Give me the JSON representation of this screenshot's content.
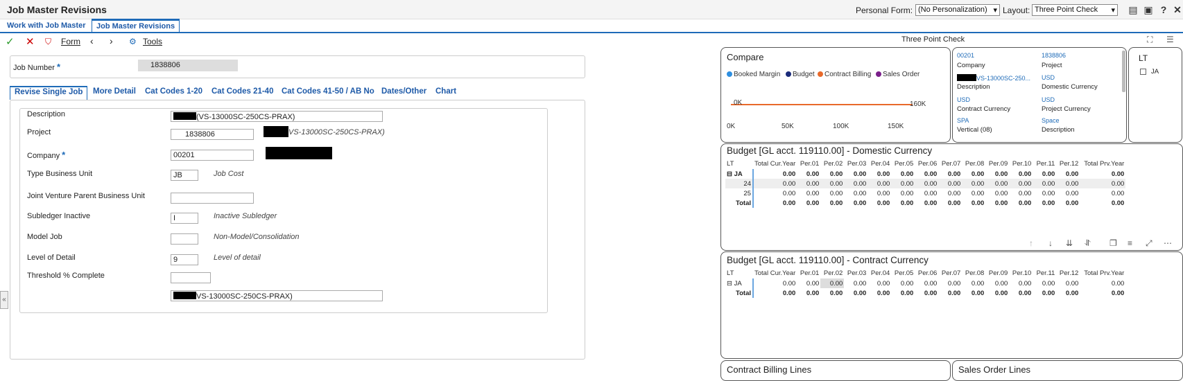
{
  "header": {
    "title": "Job Master Revisions",
    "personal_form_label": "Personal Form:",
    "personal_form_value": "(No Personalization)",
    "layout_label": "Layout:",
    "layout_value": "Three Point Check"
  },
  "app_tabs": [
    "Work with Job Master",
    "Job Master Revisions"
  ],
  "toolbar": {
    "form_label": "Form",
    "tools_label": "Tools"
  },
  "job": {
    "label": "Job Number",
    "value": "1838806"
  },
  "form_tabs": [
    "Revise Single Job",
    "More Detail",
    "Cat Codes 1-20",
    "Cat Codes 21-40",
    "Cat Codes 41-50 / AB No",
    "Dates/Other",
    "Chart"
  ],
  "fields": {
    "description": {
      "label": "Description",
      "value": "(VS-13000SC-250CS-PRAX)"
    },
    "project": {
      "label": "Project",
      "value": "1838806",
      "desc": "VS-13000SC-250CS-PRAX)"
    },
    "company": {
      "label": "Company",
      "value": "00201"
    },
    "type_bu": {
      "label": "Type Business Unit",
      "value": "JB",
      "desc": "Job Cost"
    },
    "jv_parent": {
      "label": "Joint Venture Parent Business Unit",
      "value": ""
    },
    "subledger_inactive": {
      "label": "Subledger Inactive",
      "value": "I",
      "desc": "Inactive Subledger"
    },
    "model_job": {
      "label": "Model Job",
      "value": "",
      "desc": "Non-Model/Consolidation"
    },
    "level_of_detail": {
      "label": "Level of Detail",
      "value": "9",
      "desc": "Level of detail"
    },
    "threshold": {
      "label": "Threshold % Complete",
      "value": ""
    },
    "extra_desc": {
      "value": "VS-13000SC-250CS-PRAX)"
    }
  },
  "right_panel": {
    "title": "Three Point Check",
    "compare": {
      "title": "Compare",
      "legend": [
        {
          "name": "Booked Margin",
          "color": "#2e8fe0"
        },
        {
          "name": "Budget",
          "color": "#1a2b7a"
        },
        {
          "name": "Contract Billing",
          "color": "#e8692a"
        },
        {
          "name": "Sales Order",
          "color": "#7a1f8a"
        }
      ],
      "y_label_left": "0K",
      "y_label_right": "160K",
      "x_ticks": [
        "0K",
        "50K",
        "100K",
        "150K"
      ]
    },
    "info": [
      {
        "value": "00201",
        "label": "Company"
      },
      {
        "value": "1838806",
        "label": "Project"
      },
      {
        "value": "VS-13000SC-250...",
        "label": "Description"
      },
      {
        "value": "USD",
        "label": "Domestic Currency"
      },
      {
        "value": "USD",
        "label": "Contract Currency"
      },
      {
        "value": "USD",
        "label": "Project Currency"
      },
      {
        "value": "SPA",
        "label": "Vertical (08)"
      },
      {
        "value": "Space",
        "label": "Description"
      }
    ],
    "lt": {
      "title": "LT",
      "item": "JA"
    },
    "budget_domestic": {
      "title": "Budget [GL acct. 119110.00] - Domestic Currency",
      "columns": [
        "LT",
        "Total Cur.Year",
        "Per.01",
        "Per.02",
        "Per.03",
        "Per.04",
        "Per.05",
        "Per.06",
        "Per.07",
        "Per.08",
        "Per.09",
        "Per.10",
        "Per.11",
        "Per.12",
        "Total Prv.Year"
      ],
      "rows": [
        {
          "lt": "JA",
          "vals": [
            "0.00",
            "0.00",
            "0.00",
            "0.00",
            "0.00",
            "0.00",
            "0.00",
            "0.00",
            "0.00",
            "0.00",
            "0.00",
            "0.00",
            "0.00",
            "0.00"
          ]
        },
        {
          "lt": "24",
          "vals": [
            "0.00",
            "0.00",
            "0.00",
            "0.00",
            "0.00",
            "0.00",
            "0.00",
            "0.00",
            "0.00",
            "0.00",
            "0.00",
            "0.00",
            "0.00",
            "0.00"
          ]
        },
        {
          "lt": "25",
          "vals": [
            "0.00",
            "0.00",
            "0.00",
            "0.00",
            "0.00",
            "0.00",
            "0.00",
            "0.00",
            "0.00",
            "0.00",
            "0.00",
            "0.00",
            "0.00",
            "0.00"
          ]
        },
        {
          "lt": "Total",
          "vals": [
            "0.00",
            "0.00",
            "0.00",
            "0.00",
            "0.00",
            "0.00",
            "0.00",
            "0.00",
            "0.00",
            "0.00",
            "0.00",
            "0.00",
            "0.00",
            "0.00"
          ]
        }
      ]
    },
    "budget_contract": {
      "title": "Budget [GL acct. 119110.00] - Contract Currency",
      "columns": [
        "LT",
        "Total Cur.Year",
        "Per.01",
        "Per.02",
        "Per.03",
        "Per.04",
        "Per.05",
        "Per.06",
        "Per.07",
        "Per.08",
        "Per.09",
        "Per.10",
        "Per.11",
        "Per.12",
        "Total Prv.Year"
      ],
      "rows": [
        {
          "lt": "JA",
          "vals": [
            "0.00",
            "0.00",
            "0.00",
            "0.00",
            "0.00",
            "0.00",
            "0.00",
            "0.00",
            "0.00",
            "0.00",
            "0.00",
            "0.00",
            "0.00",
            "0.00"
          ]
        },
        {
          "lt": "Total",
          "vals": [
            "0.00",
            "0.00",
            "0.00",
            "0.00",
            "0.00",
            "0.00",
            "0.00",
            "0.00",
            "0.00",
            "0.00",
            "0.00",
            "0.00",
            "0.00",
            "0.00"
          ]
        }
      ]
    },
    "bottom_cards": [
      "Contract Billing Lines",
      "Sales Order Lines"
    ]
  }
}
